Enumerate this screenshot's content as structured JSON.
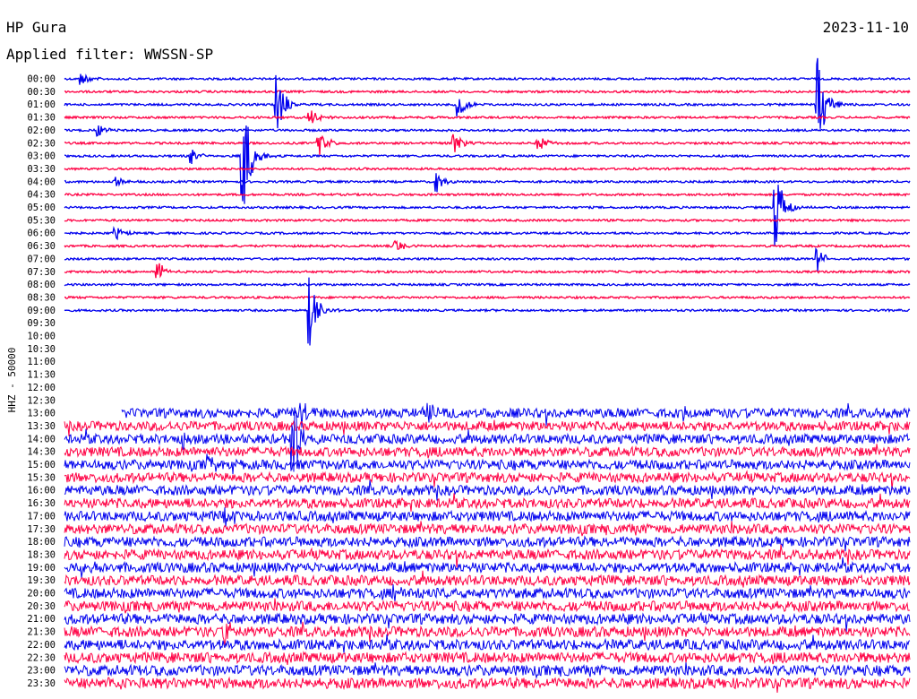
{
  "header": {
    "station": "HP Gura",
    "date": "2023-11-10",
    "filter": "Applied filter: WWSSN-SP"
  },
  "chart_data": {
    "type": "line",
    "title": "HP Gura",
    "subtitle": "Applied filter: WWSSN-SP",
    "ylabel": "HHZ - 50000",
    "grid": false,
    "legend": "none",
    "colors": [
      "#0000ee",
      "#ff0044"
    ],
    "time_labels": [
      "00:00",
      "00:30",
      "01:00",
      "01:30",
      "02:00",
      "02:30",
      "03:00",
      "03:30",
      "04:00",
      "04:30",
      "05:00",
      "05:30",
      "06:00",
      "06:30",
      "07:00",
      "07:30",
      "08:00",
      "08:30",
      "09:00",
      "09:30",
      "10:00",
      "10:30",
      "11:00",
      "11:30",
      "12:00",
      "12:30",
      "13:00",
      "13:30",
      "14:00",
      "14:30",
      "15:00",
      "15:30",
      "16:00",
      "16:30",
      "17:00",
      "17:30",
      "18:00",
      "18:30",
      "19:00",
      "19:30",
      "20:00",
      "20:30",
      "21:00",
      "21:30",
      "22:00",
      "22:30",
      "23:00",
      "23:30"
    ],
    "data_start_trace": 0,
    "data_gap": [
      "09:30",
      "12:30"
    ],
    "noise_increase_from": "13:00",
    "events": [
      {
        "trace": 0,
        "pos": 0.02,
        "amp": 8
      },
      {
        "trace": 2,
        "pos": 0.25,
        "amp": 40
      },
      {
        "trace": 2,
        "pos": 0.465,
        "amp": 15
      },
      {
        "trace": 2,
        "pos": 0.89,
        "amp": 70
      },
      {
        "trace": 3,
        "pos": 0.29,
        "amp": 12
      },
      {
        "trace": 4,
        "pos": 0.04,
        "amp": 8
      },
      {
        "trace": 5,
        "pos": 0.3,
        "amp": 18
      },
      {
        "trace": 5,
        "pos": 0.46,
        "amp": 14
      },
      {
        "trace": 5,
        "pos": 0.56,
        "amp": 10
      },
      {
        "trace": 6,
        "pos": 0.21,
        "amp": 85
      },
      {
        "trace": 6,
        "pos": 0.15,
        "amp": 10
      },
      {
        "trace": 8,
        "pos": 0.06,
        "amp": 6
      },
      {
        "trace": 8,
        "pos": 0.44,
        "amp": 12
      },
      {
        "trace": 10,
        "pos": 0.84,
        "amp": 60
      },
      {
        "trace": 12,
        "pos": 0.06,
        "amp": 8
      },
      {
        "trace": 13,
        "pos": 0.39,
        "amp": 10
      },
      {
        "trace": 14,
        "pos": 0.89,
        "amp": 16
      },
      {
        "trace": 15,
        "pos": 0.11,
        "amp": 12
      },
      {
        "trace": 18,
        "pos": 0.29,
        "amp": 40
      },
      {
        "trace": 26,
        "pos": 0.28,
        "amp": 20
      },
      {
        "trace": 26,
        "pos": 0.43,
        "amp": 12
      },
      {
        "trace": 26,
        "pos": 0.73,
        "amp": 14
      },
      {
        "trace": 28,
        "pos": 0.27,
        "amp": 50
      },
      {
        "trace": 28,
        "pos": 0.14,
        "amp": 12
      },
      {
        "trace": 30,
        "pos": 0.17,
        "amp": 10
      },
      {
        "trace": 34,
        "pos": 0.19,
        "amp": 15
      },
      {
        "trace": 38,
        "pos": 0.02,
        "amp": 10
      },
      {
        "trace": 40,
        "pos": 0.39,
        "amp": 10
      },
      {
        "trace": 43,
        "pos": 0.19,
        "amp": 14
      },
      {
        "trace": 47,
        "pos": 0.05,
        "amp": 10
      }
    ]
  }
}
